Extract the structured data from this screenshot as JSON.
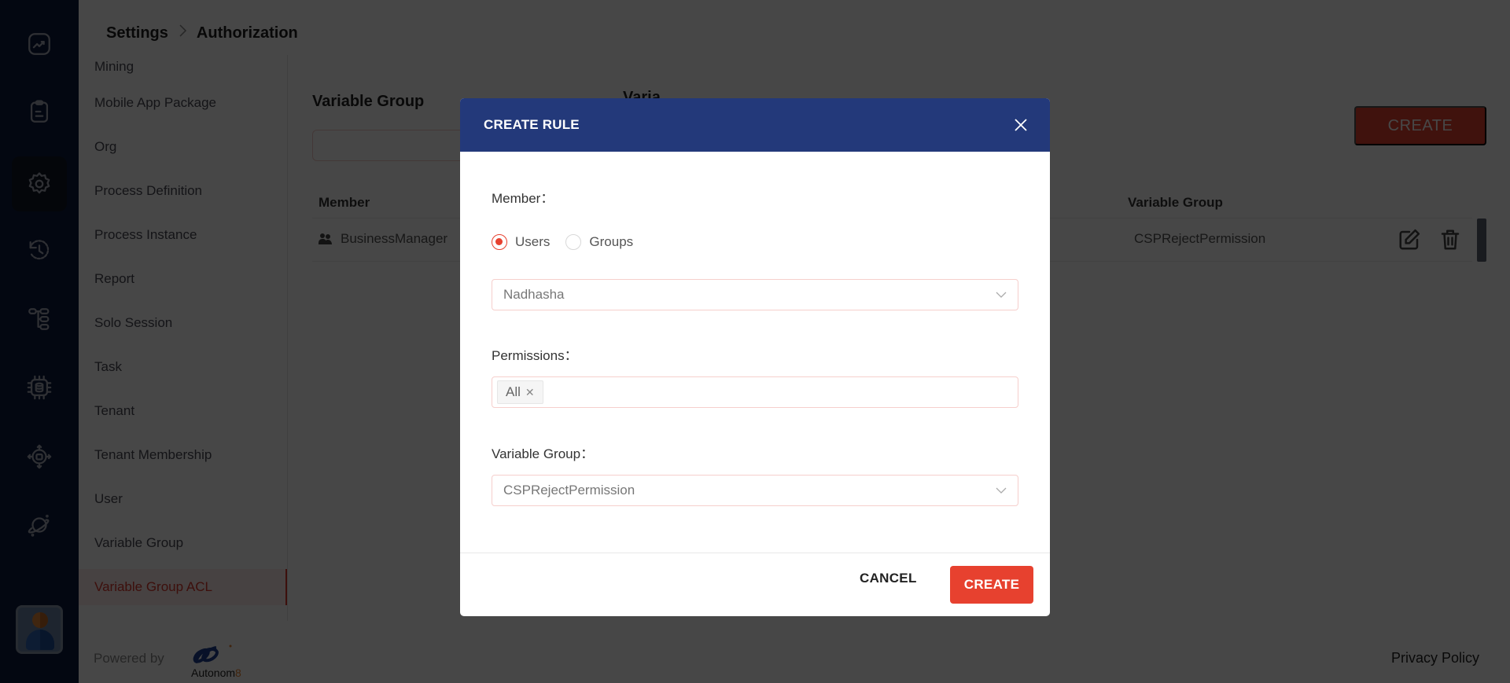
{
  "breadcrumb": {
    "items": [
      "Settings",
      "Authorization"
    ],
    "separator": "›"
  },
  "rail": {
    "icons": [
      "analytics-icon",
      "clipboard-icon",
      "settings-icon",
      "history-icon",
      "hierarchy-icon",
      "chip-database-icon",
      "deploy-icon",
      "planet-icon"
    ],
    "active": "settings-icon"
  },
  "submenu": {
    "items": [
      {
        "label": "Mining"
      },
      {
        "label": "Mobile App Package"
      },
      {
        "label": "Org"
      },
      {
        "label": "Process Definition"
      },
      {
        "label": "Process Instance"
      },
      {
        "label": "Report"
      },
      {
        "label": "Solo Session"
      },
      {
        "label": "Task"
      },
      {
        "label": "Tenant"
      },
      {
        "label": "Tenant Membership"
      },
      {
        "label": "User"
      },
      {
        "label": "Variable Group"
      },
      {
        "label": "Variable Group ACL",
        "active": true
      }
    ]
  },
  "main": {
    "section_title": "Variable Group",
    "section_title_2": "Varia",
    "create_label": "CREATE",
    "table": {
      "columns": [
        "Member",
        "Variable Group"
      ],
      "rows": [
        {
          "member": "BusinessManager",
          "member_icon": "group-icon",
          "variable_group": "CSPRejectPermission"
        }
      ]
    }
  },
  "footer": {
    "powered_by": "Powered by",
    "brand_prefix": "Autonom",
    "brand_suffix": "8",
    "privacy": "Privacy Policy"
  },
  "modal": {
    "title": "CREATE RULE",
    "member_label": "Member：",
    "member_options": [
      {
        "label": "Users",
        "checked": true
      },
      {
        "label": "Groups",
        "checked": false
      }
    ],
    "member_value": "Nadhasha",
    "permissions_label": "Permissions：",
    "permissions_tags": [
      "All"
    ],
    "variable_group_label": "Variable Group：",
    "variable_group_value": "CSPRejectPermission",
    "cancel_label": "CANCEL",
    "create_label": "CREATE"
  },
  "colors": {
    "accent": "#e7412f",
    "modal_header": "#23397a",
    "rail": "#0d1b3e"
  }
}
